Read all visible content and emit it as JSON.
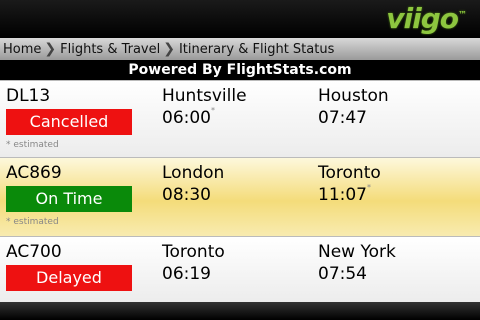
{
  "app": {
    "logo_text": "viigo",
    "logo_mark": "™"
  },
  "breadcrumb": {
    "items": [
      {
        "label": "Home"
      },
      {
        "label": "Flights & Travel"
      },
      {
        "label": "Itinerary & Flight Status"
      }
    ]
  },
  "powered_by": "Powered By FlightStats.com",
  "estimated_mark": "*",
  "estimated_note": "* estimated",
  "flights": [
    {
      "number": "DL13",
      "status": "Cancelled",
      "status_color": "#ee1111",
      "origin": "Huntsville",
      "depart_time": "06:00",
      "depart_estimated": true,
      "destination": "Houston",
      "arrive_time": "07:47",
      "arrive_estimated": false
    },
    {
      "number": "AC869",
      "status": "On Time",
      "status_color": "#0a8a0a",
      "origin": "London",
      "depart_time": "08:30",
      "depart_estimated": false,
      "destination": "Toronto",
      "arrive_time": "11:07",
      "arrive_estimated": true
    },
    {
      "number": "AC700",
      "status": "Delayed",
      "status_color": "#ee1111",
      "origin": "Toronto",
      "depart_time": "06:19",
      "depart_estimated": false,
      "destination": "New York",
      "arrive_time": "07:54",
      "arrive_estimated": false
    }
  ]
}
